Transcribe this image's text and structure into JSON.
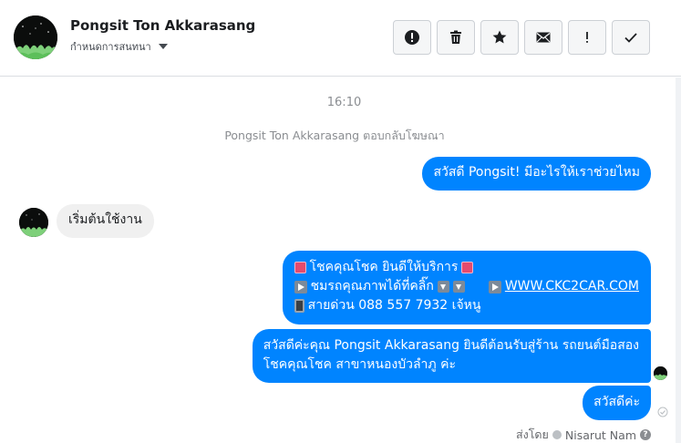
{
  "header": {
    "contact_name": "Pongsit Ton Akkarasang",
    "status_label": "กำหนดการสนทนา",
    "actions": [
      {
        "name": "report-button",
        "icon": "exclamation-circle-icon"
      },
      {
        "name": "delete-button",
        "icon": "trash-icon"
      },
      {
        "name": "star-button",
        "icon": "star-icon"
      },
      {
        "name": "mark-unread-button",
        "icon": "envelope-icon"
      },
      {
        "name": "priority-button",
        "icon": "exclamation-icon"
      },
      {
        "name": "done-button",
        "icon": "check-icon"
      }
    ]
  },
  "chat": {
    "timestamp": "16:10",
    "system_message": "Pongsit Ton Akkarasang ตอบกลับโฆษณา",
    "messages": {
      "greeting": "สวัสดี Pongsit! มีอะไรให้เราช่วยไหม",
      "reply_in": "เริ่มต้นใช้งาน",
      "promo_line1": "โชคคุณโชค ยินดีให้บริการ",
      "promo_line2_text": "ชมรถคุณภาพได้ที่คลิ๊ก",
      "promo_link": "WWW.CKC2CAR.COM",
      "promo_line3": "สายด่วน 088 557 7932 เจ้หนู",
      "welcome_line1": "สวัสดีค่ะคุณ Pongsit Akkarasang ยินดีต้อนรับสู่ร้าน รถยนต์มือสอง",
      "welcome_line2": "โชคคุณโชค สาขาหนองบัวลำภู ค่ะ",
      "closing": "สวัสดีค่ะ"
    },
    "sent_by_label": "ส่งโดย",
    "sent_by_name": "Nisarut Nam"
  },
  "colors": {
    "outgoing_bubble": "#0084ff",
    "incoming_bubble": "#f0f0f0",
    "muted_text": "#8a8d91"
  }
}
